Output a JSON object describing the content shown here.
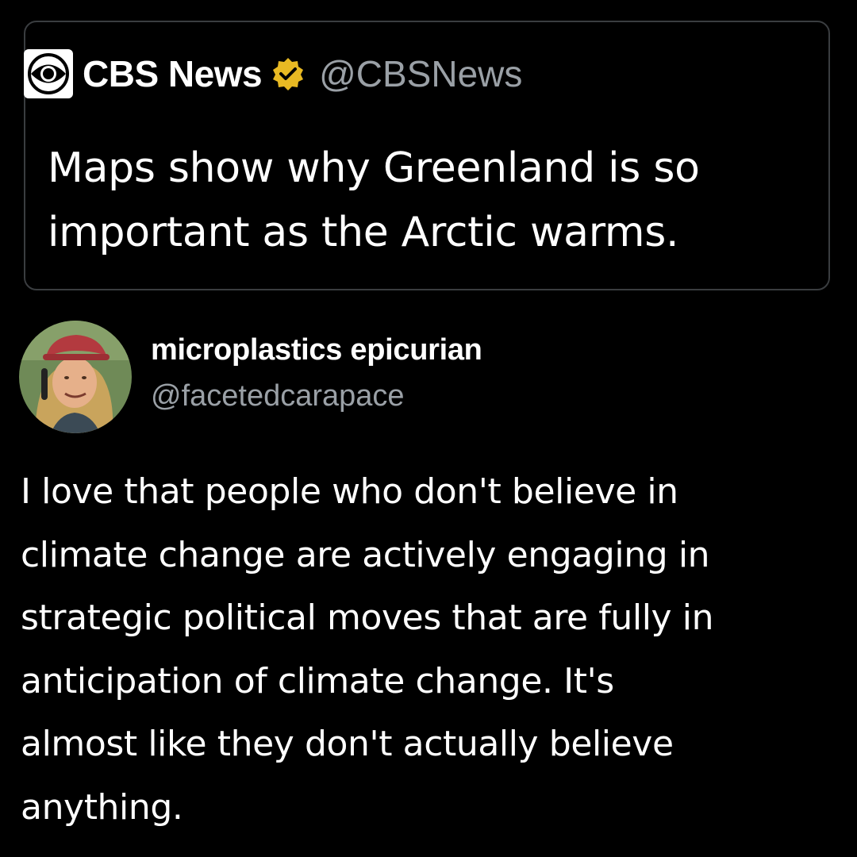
{
  "quoted_tweet": {
    "author_name": "CBS News",
    "author_handle": "@CBSNews",
    "logo_icon": "cbs-eye-logo",
    "verified_color": "#e8b923",
    "text": "Maps show why Greenland is so important as the Arctic warms."
  },
  "tweet": {
    "author_name": "microplastics epicurian",
    "author_handle": "@facetedcarapace",
    "avatar_icon": "user-avatar-photo",
    "text_lines": [
      "I love that people who don't believe in",
      "climate change are actively engaging in",
      "strategic political moves that are fully in",
      "anticipation of climate change. It's",
      "almost like they don't actually believe",
      "anything."
    ]
  },
  "colors": {
    "background": "#000000",
    "text_primary": "#ffffff",
    "text_secondary": "#9aa0a6",
    "border": "#3a3d40"
  }
}
